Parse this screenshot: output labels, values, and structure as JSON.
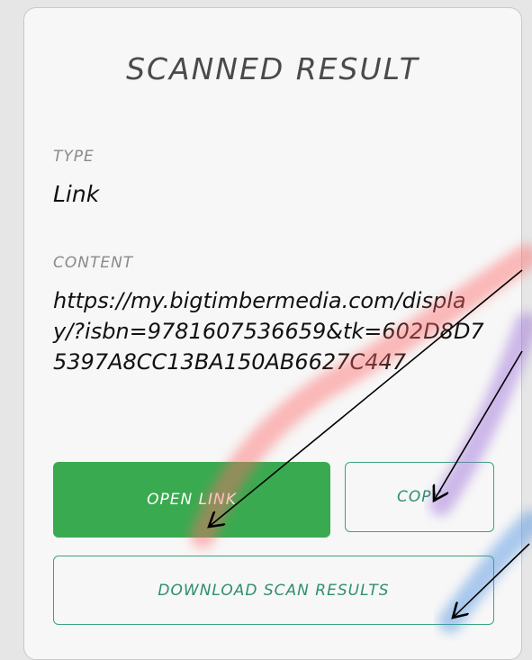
{
  "dialog": {
    "title": "SCANNED RESULT",
    "type_label": "TYPE",
    "type_value": "Link",
    "content_label": "CONTENT",
    "content_value": "https://my.bigtimbermedia.com/display/?isbn=9781607536659&tk=602D8D75397A8CC13BA150AB6627C447"
  },
  "buttons": {
    "open_link": "OPEN LINK",
    "copy": "COPY",
    "download": "DOWNLOAD SCAN RESULTS"
  },
  "colors": {
    "primary": "#3aaa50",
    "outline": "#3aa57a",
    "highlight_red": "#ff6b6b",
    "highlight_purple": "#9a6bd8",
    "highlight_blue": "#4a8fe0"
  }
}
